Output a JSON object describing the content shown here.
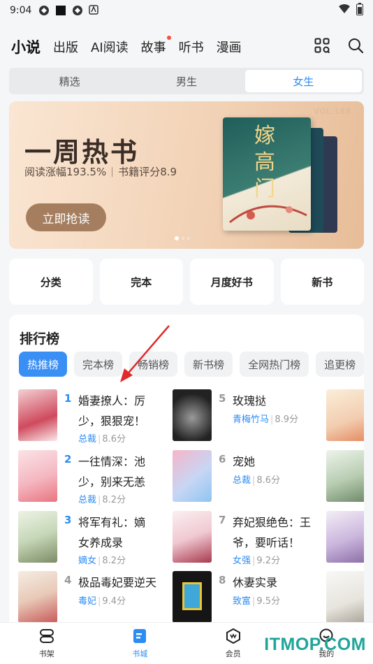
{
  "status_bar": {
    "time": "9:04"
  },
  "top_nav": {
    "tabs": [
      {
        "label": "小说",
        "active": true
      },
      {
        "label": "出版"
      },
      {
        "label": "AI阅读"
      },
      {
        "label": "故事",
        "badge_dot": true
      },
      {
        "label": "听书"
      },
      {
        "label": "漫画"
      }
    ],
    "icons": [
      "grid-icon",
      "search-icon"
    ]
  },
  "segment": {
    "items": [
      "精选",
      "男生",
      "女生"
    ],
    "active": "女生"
  },
  "banner": {
    "vol": "VOL.188",
    "title": "一周热书",
    "growth": "阅读涨幅193.5%",
    "score": "书籍评分8.9",
    "cta": "立即抢读",
    "cover_text": "嫁高门"
  },
  "quick_links": [
    "分类",
    "完本",
    "月度好书",
    "新书"
  ],
  "ranking": {
    "title": "排行榜",
    "tabs": [
      "热推榜",
      "完本榜",
      "畅销榜",
      "新书榜",
      "全网热门榜",
      "追更榜"
    ],
    "active_tab": "热推榜",
    "books": [
      {
        "rank": "1",
        "name": "婚妻撩人：厉少，狠狠宠！",
        "tag": "总裁",
        "score": "8.6分"
      },
      {
        "rank": "2",
        "name": "一往情深：池少，别来无恙",
        "tag": "总裁",
        "score": "8.2分"
      },
      {
        "rank": "3",
        "name": "将军有礼：嫡女养成录",
        "tag": "嫡女",
        "score": "8.2分"
      },
      {
        "rank": "4",
        "name": "极品毒妃要逆天",
        "tag": "毒妃",
        "score": "9.4分"
      },
      {
        "rank": "5",
        "name": "玫瑰挞",
        "tag": "青梅竹马",
        "score": "8.9分"
      },
      {
        "rank": "6",
        "name": "宠她",
        "tag": "总裁",
        "score": "8.6分"
      },
      {
        "rank": "7",
        "name": "弃妃狠绝色：王爷，要听话！",
        "tag": "女强",
        "score": "9.2分"
      },
      {
        "rank": "8",
        "name": "休妻实录",
        "tag": "致富",
        "score": "9.5分"
      }
    ]
  },
  "tabbar": [
    {
      "label": "书架",
      "icon": "bookshelf-icon"
    },
    {
      "label": "书城",
      "icon": "bookstore-icon",
      "active": true
    },
    {
      "label": "会员",
      "icon": "vip-icon"
    },
    {
      "label": "我的",
      "icon": "profile-icon"
    }
  ],
  "watermark": "ITMOP.COM",
  "colors": {
    "accent": "#2b8cf3",
    "chip_active": "#3a8ff5",
    "cta": "#a57e5f"
  }
}
